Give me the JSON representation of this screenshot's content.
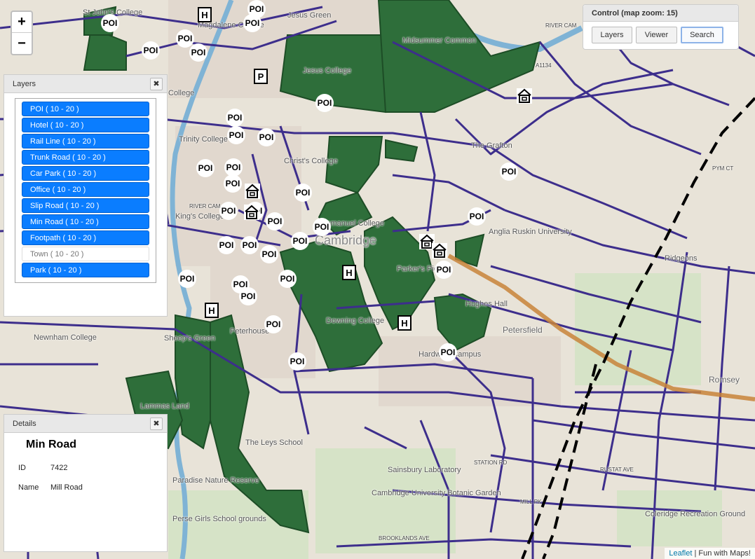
{
  "zoom": {
    "in_label": "+",
    "out_label": "−"
  },
  "layers_panel": {
    "title": "Layers",
    "close_label": "✖",
    "items": [
      {
        "label": "POI ( 10 - 20 )",
        "on": true
      },
      {
        "label": "Hotel ( 10 - 20 )",
        "on": true
      },
      {
        "label": "Rail Line ( 10 - 20 )",
        "on": true
      },
      {
        "label": "Trunk Road ( 10 - 20 )",
        "on": true
      },
      {
        "label": "Car Park ( 10 - 20 )",
        "on": true
      },
      {
        "label": "Office ( 10 - 20 )",
        "on": true
      },
      {
        "label": "Slip Road ( 10 - 20 )",
        "on": true
      },
      {
        "label": "Min Road ( 10 - 20 )",
        "on": true
      },
      {
        "label": "Footpath ( 10 - 20 )",
        "on": true
      },
      {
        "label": "Town ( 10 - 20 )",
        "on": false
      },
      {
        "label": "Park ( 10 - 20 )",
        "on": true
      }
    ]
  },
  "details_panel": {
    "title": "Details",
    "close_label": "✖",
    "feature_title": "Min Road",
    "rows": [
      {
        "key": "ID",
        "value": "7422"
      },
      {
        "key": "Name",
        "value": "Mill Road"
      }
    ]
  },
  "control_panel": {
    "title": "Control (map zoom: 15)",
    "buttons": [
      {
        "label": "Layers",
        "active": false
      },
      {
        "label": "Viewer",
        "active": false
      },
      {
        "label": "Search",
        "active": true
      }
    ]
  },
  "attribution": {
    "leaflet": "Leaflet",
    "sep": " | ",
    "credit": "Fun with Maps!"
  },
  "map": {
    "colors": {
      "road": "#3d2e8c",
      "park": "#2e6e3a",
      "trunk": "#c8843a",
      "rail": "#000000",
      "base": "#e8e3d8"
    },
    "place_labels": [
      "St John's College",
      "Jesus Green",
      "Magdalene College",
      "River Cam",
      "Midsummer Common",
      "Jesus College",
      "College",
      "Trinity College",
      "Christ's College",
      "The Grafton",
      "A1134",
      "PYM CT",
      "King's College",
      "Emmanuel College",
      "Cambridge",
      "Anglia Ruskin University",
      "Parker's Piece",
      "Ridgeons",
      "Hughes Hall",
      "Petersfield",
      "Downing College",
      "Peterhouse",
      "Sheep's Green",
      "Newnham College",
      "Hardwick Campus",
      "Romsey",
      "Lammas Land",
      "The Leys School",
      "Sainsbury Laboratory",
      "Cambridge University Botanic Garden",
      "Paradise Nature Reserve",
      "Perse Girls School grounds",
      "Coleridge Recreation Ground",
      "BROOKLANDS AVE",
      "STATION RD",
      "RUSTAT AVE",
      "MILL PK",
      "River Cam"
    ],
    "poi_text": "POI",
    "hotel_text": "H",
    "parking_text": "P"
  }
}
